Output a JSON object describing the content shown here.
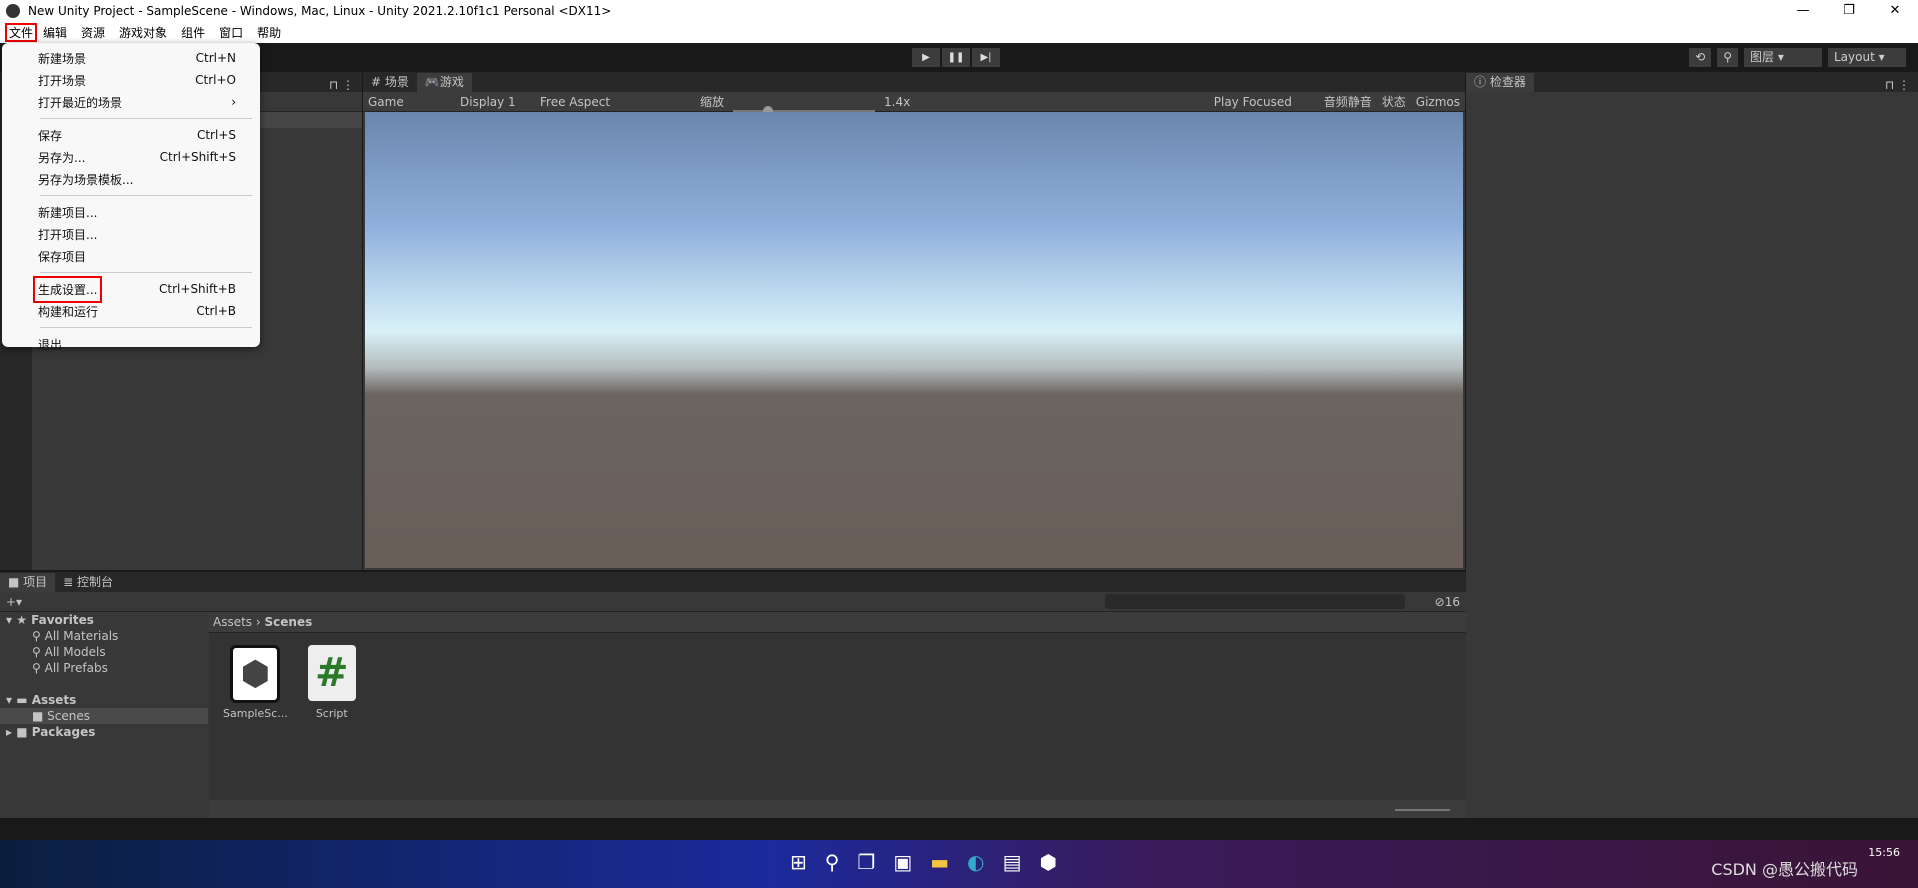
{
  "window": {
    "title": "New Unity Project - SampleScene - Windows, Mac, Linux - Unity 2021.2.10f1c1 Personal <DX11>",
    "minimize": "—",
    "maximize": "❐",
    "close": "✕"
  },
  "menubar": [
    "文件",
    "编辑",
    "资源",
    "游戏对象",
    "组件",
    "窗口",
    "帮助"
  ],
  "file_menu": {
    "groups": [
      [
        {
          "label": "新建场景",
          "shortcut": "Ctrl+N"
        },
        {
          "label": "打开场景",
          "shortcut": "Ctrl+O"
        },
        {
          "label": "打开最近的场景",
          "shortcut": "›"
        }
      ],
      [
        {
          "label": "保存",
          "shortcut": "Ctrl+S"
        },
        {
          "label": "另存为...",
          "shortcut": "Ctrl+Shift+S"
        },
        {
          "label": "另存为场景模板...",
          "shortcut": ""
        }
      ],
      [
        {
          "label": "新建项目...",
          "shortcut": ""
        },
        {
          "label": "打开项目...",
          "shortcut": ""
        },
        {
          "label": "保存项目",
          "shortcut": ""
        }
      ],
      [
        {
          "label": "生成设置...",
          "shortcut": "Ctrl+Shift+B",
          "highlighted": true
        },
        {
          "label": "构建和运行",
          "shortcut": "Ctrl+B"
        }
      ],
      [
        {
          "label": "退出",
          "shortcut": ""
        }
      ]
    ]
  },
  "toolbar": {
    "play": "▶",
    "pause": "❚❚",
    "step": "▶|",
    "history": "⟲",
    "search": "⚲",
    "layers": "图层 ▾",
    "layout": "Layout ▾"
  },
  "scene_tabs": [
    {
      "label": "场景",
      "icon": "#"
    },
    {
      "label": "游戏",
      "icon": "gamepad"
    }
  ],
  "game_toolbar": {
    "mode": "Game",
    "display": "Display 1",
    "aspect": "Free Aspect",
    "scale_label": "缩放",
    "scale": "1.4x",
    "play_focused": "Play Focused",
    "mute": "音频静音",
    "stats": "状态",
    "gizmos": "Gizmos"
  },
  "inspector": {
    "tab": "检查器"
  },
  "project": {
    "tabs": [
      "项目",
      "控制台"
    ],
    "add": "+▾",
    "favorites": "Favorites",
    "fav_items": [
      "All Materials",
      "All Models",
      "All Prefabs"
    ],
    "assets": "Assets",
    "scenes": "Scenes",
    "packages": "Packages",
    "breadcrumb": [
      "Assets",
      "Scenes"
    ],
    "files": [
      {
        "name": "SampleSc...",
        "type": "scene"
      },
      {
        "name": "Script",
        "type": "script"
      }
    ],
    "hidden_count": "16"
  },
  "taskbar": {
    "time": "15:56",
    "watermark": "CSDN @愚公搬代码"
  },
  "colors": {
    "accent_highlight": "#e00000",
    "script_hash": "#2a7a2a"
  }
}
